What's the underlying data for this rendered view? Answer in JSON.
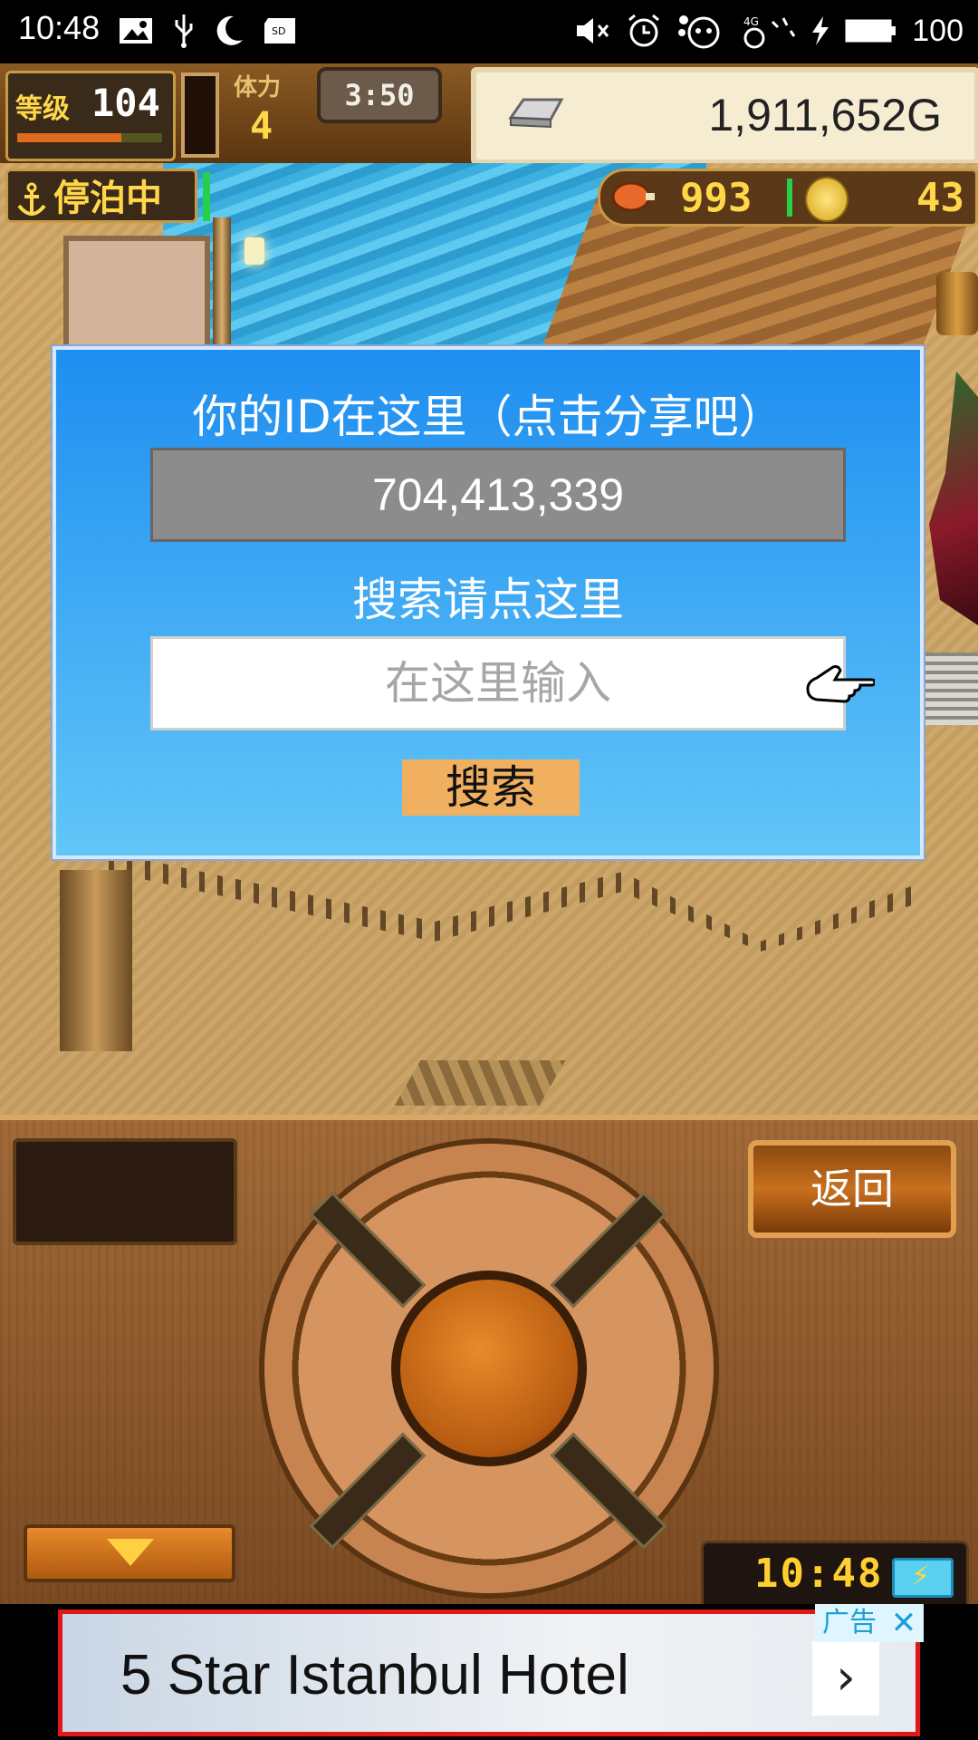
{
  "status_bar": {
    "time": "10:48",
    "battery": "100",
    "icons": [
      "image-icon",
      "usb-icon",
      "moon-icon",
      "sd-card-icon",
      "mute-icon",
      "alarm-icon",
      "emoji-icon",
      "signal-4g-icon",
      "charging-icon",
      "battery-icon"
    ]
  },
  "hud": {
    "level_label": "等级",
    "level": "104",
    "stamina_label": "体力",
    "stamina": "4",
    "timer": "3:50",
    "gold": "1,911,652G"
  },
  "scene": {
    "status_label": "停泊中",
    "food": "993",
    "coins": "43"
  },
  "dialog": {
    "title": "你的ID在这里（点击分享吧）",
    "player_id": "704,413,339",
    "search_label": "搜索请点这里",
    "search_placeholder": "在这里输入",
    "search_button": "搜索"
  },
  "panel": {
    "back_button": "返回",
    "clock": "10:48"
  },
  "ad": {
    "tag": "广告",
    "close": "✕",
    "text": "5 Star Istanbul Hotel",
    "arrow": "›"
  },
  "colors": {
    "dialog_top": "#1e8ef0",
    "dialog_bottom": "#62c6f8",
    "search_button": "#f0b060",
    "ad_border": "#e01818"
  }
}
